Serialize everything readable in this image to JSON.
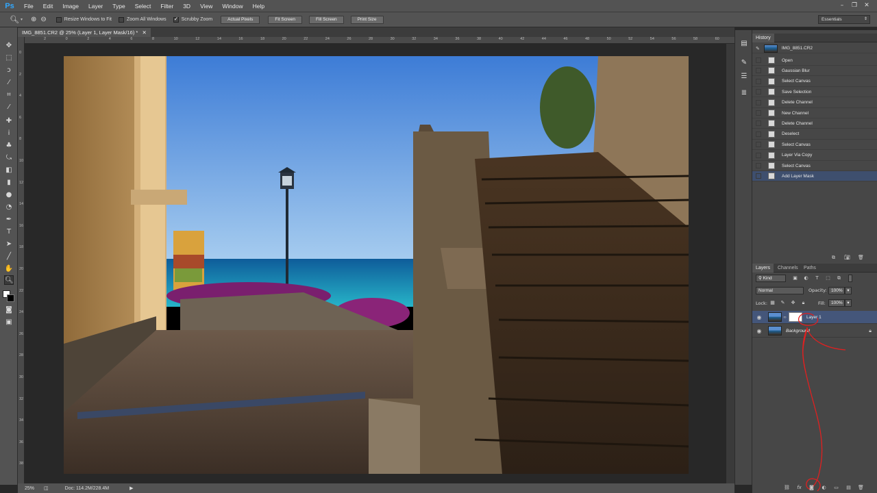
{
  "app": {
    "logo": "Ps",
    "menu": [
      "File",
      "Edit",
      "Image",
      "Layer",
      "Type",
      "Select",
      "Filter",
      "3D",
      "View",
      "Window",
      "Help"
    ]
  },
  "options_bar": {
    "checkboxes": [
      {
        "label": "Resize Windows to Fit",
        "checked": false
      },
      {
        "label": "Zoom All Windows",
        "checked": false
      },
      {
        "label": "Scrubby Zoom",
        "checked": true
      }
    ],
    "buttons": [
      "Actual Pixels",
      "Fit Screen",
      "Fill Screen",
      "Print Size"
    ],
    "workspace": "Essentials"
  },
  "document": {
    "tab_title": "IMG_8851.CR2 @ 25% (Layer 1, Layer Mask/16) *",
    "ruler_h": [
      "2",
      "0",
      "2",
      "4",
      "6",
      "8",
      "10",
      "12",
      "14",
      "16",
      "18",
      "20",
      "22",
      "24",
      "26",
      "28",
      "30",
      "32",
      "34",
      "36",
      "38",
      "40",
      "42",
      "44",
      "46",
      "48",
      "50",
      "52",
      "54",
      "56",
      "58",
      "60"
    ],
    "ruler_v": [
      "0",
      "2",
      "4",
      "6",
      "8",
      "10",
      "12",
      "14",
      "16",
      "18",
      "20",
      "22",
      "24",
      "26",
      "28",
      "30",
      "32",
      "34",
      "36",
      "38"
    ]
  },
  "status": {
    "zoom": "25%",
    "doc_size": "Doc: 114.2M/228.4M"
  },
  "history": {
    "title": "History",
    "snapshot": "IMG_8851.CR2",
    "items": [
      "Open",
      "Gaussian Blur",
      "Select Canvas",
      "Save Selection",
      "Delete Channel",
      "New Channel",
      "Delete Channel",
      "Deselect",
      "Select Canvas",
      "Layer Via Copy",
      "Select Canvas",
      "Add Layer Mask"
    ],
    "selected_index": 11
  },
  "layers_panel": {
    "tabs": [
      "Layers",
      "Channels",
      "Paths"
    ],
    "filter_kind": "Kind",
    "blend_mode": "Normal",
    "opacity_label": "Opacity:",
    "opacity": "100%",
    "lock_label": "Lock:",
    "fill_label": "Fill:",
    "fill": "100%",
    "layers": [
      {
        "name": "Layer 1",
        "selected": true,
        "has_mask": true
      },
      {
        "name": "Background",
        "selected": false,
        "has_mask": false,
        "locked": true
      }
    ]
  },
  "colors": {
    "accent": "#31a8ff",
    "selection": "#44567a",
    "annotation": "#e02020"
  }
}
